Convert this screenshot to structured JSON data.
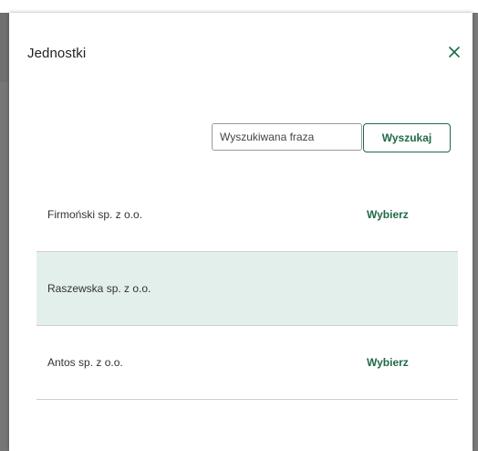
{
  "modal": {
    "title": "Jednostki",
    "close_icon": "close-icon",
    "accent_color": "#1f6b46"
  },
  "search": {
    "placeholder": "Wyszukiwana fraza",
    "value": "",
    "button_label": "Wyszukaj"
  },
  "units": [
    {
      "name": "Firmoński sp. z o.o.",
      "action_label": "Wybierz",
      "selected": false
    },
    {
      "name": "Raszewska sp. z o.o.",
      "action_label": "",
      "selected": true
    },
    {
      "name": "Antos sp. z o.o.",
      "action_label": "Wybierz",
      "selected": false
    }
  ]
}
